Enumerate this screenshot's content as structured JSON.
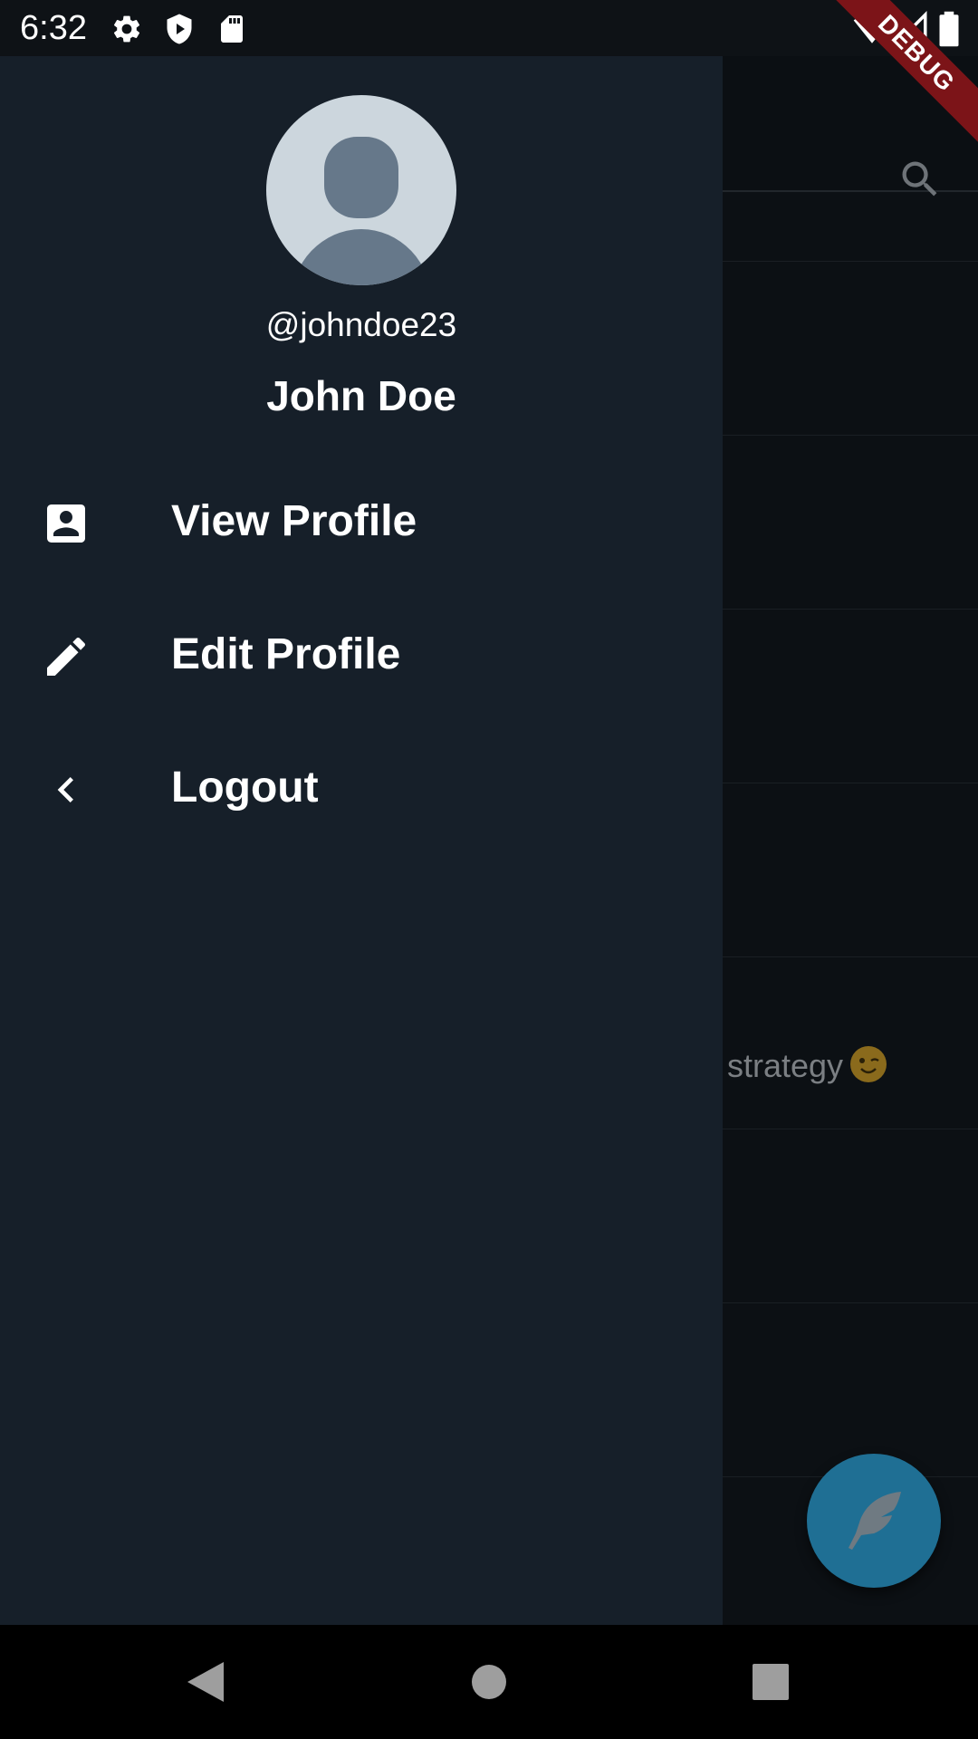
{
  "status_bar": {
    "time": "6:32",
    "icons": [
      "gear-icon",
      "shield-play-icon",
      "sd-card-icon",
      "wifi-icon",
      "signal-icon",
      "battery-icon"
    ]
  },
  "debug_banner": "DEBUG",
  "background_feed": {
    "visible_text": "strategy",
    "emoji": "winking-face"
  },
  "drawer": {
    "handle": "@johndoe23",
    "name": "John Doe",
    "items": [
      {
        "label": "View Profile",
        "icon": "account-box-icon"
      },
      {
        "label": "Edit Profile",
        "icon": "pencil-icon"
      },
      {
        "label": "Logout",
        "icon": "chevron-left-icon"
      }
    ]
  },
  "colors": {
    "drawer_bg": "#161f29",
    "accent_fab": "#1f6f94",
    "avatar_bg": "#ccd6dd",
    "avatar_figure": "#66788a",
    "debug_ribbon": "#7c1418"
  },
  "nav_bar": {
    "buttons": [
      "back-icon",
      "home-icon",
      "recents-icon"
    ]
  }
}
